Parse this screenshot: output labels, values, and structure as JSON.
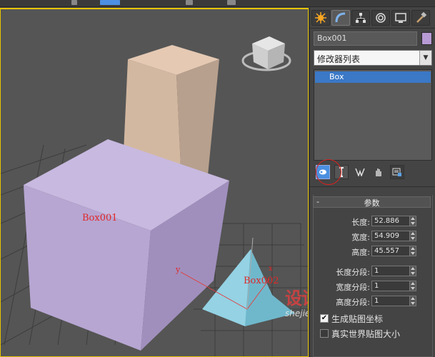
{
  "toolbar": {},
  "viewport": {
    "objects": [
      {
        "name": "Box001",
        "color": "#b9a9d4"
      },
      {
        "name": "Box002",
        "color": "#8ec9dc"
      }
    ],
    "axis_y": "y",
    "axis_x": "x",
    "watermark_main": "设计",
    "watermark_url": "shejiedu.com"
  },
  "panel": {
    "tabs": [
      "create-tab",
      "modify-tab",
      "hierarchy-tab",
      "motion-tab",
      "display-tab",
      "utilities-tab"
    ],
    "object_name": "Box001",
    "object_color": "#b89ad4",
    "modifier_list_label": "修改器列表",
    "stack": [
      {
        "label": "Box"
      }
    ],
    "rollout_title": "参数",
    "params": {
      "length": {
        "label": "长度:",
        "value": "52.886"
      },
      "width": {
        "label": "宽度:",
        "value": "54.909"
      },
      "height": {
        "label": "高度:",
        "value": "45.557"
      },
      "length_segs": {
        "label": "长度分段:",
        "value": "1"
      },
      "width_segs": {
        "label": "宽度分段:",
        "value": "1"
      },
      "height_segs": {
        "label": "高度分段:",
        "value": "1"
      }
    },
    "gen_mapping": {
      "label": "生成贴图坐标",
      "checked": true
    },
    "real_world": {
      "label": "真实世界贴图大小",
      "checked": false
    }
  }
}
